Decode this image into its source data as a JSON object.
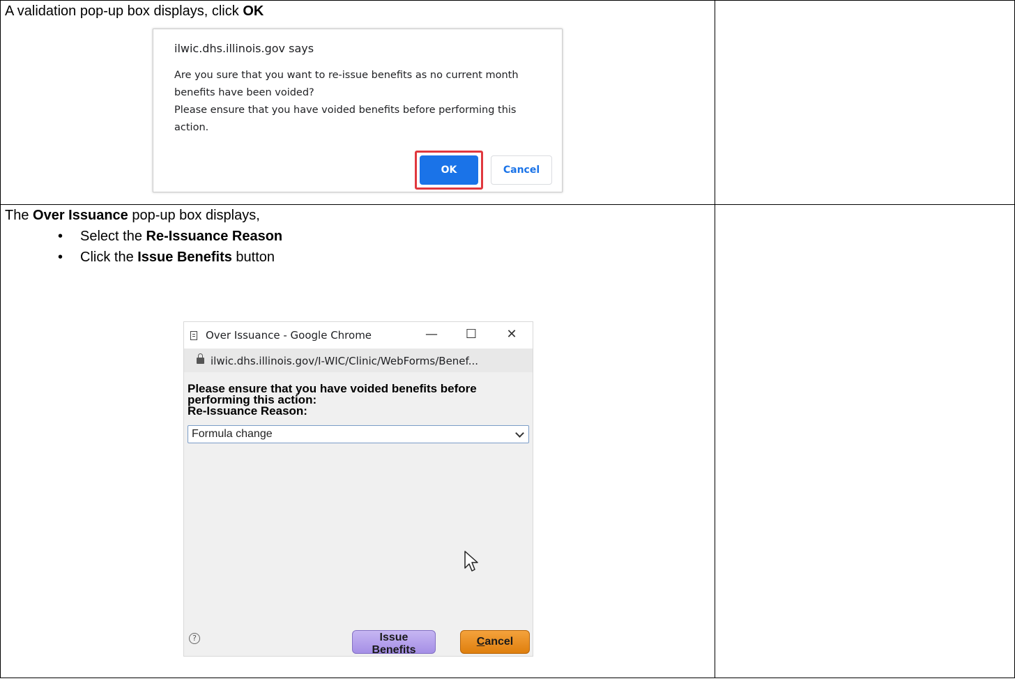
{
  "step1": {
    "text_before": "A validation pop-up box displays, click ",
    "text_bold": "OK"
  },
  "confirm_dialog": {
    "origin": "ilwic.dhs.illinois.gov says",
    "message_line1": "Are you sure that you want to re-issue benefits as no current month benefits have been voided?",
    "message_line2": "Please ensure that you have voided benefits before performing this action.",
    "ok_label": "OK",
    "cancel_label": "Cancel",
    "highlight_color": "#e0383e",
    "primary_color": "#1a73e8"
  },
  "step2": {
    "text_before": "The ",
    "text_bold": "Over Issuance",
    "text_after": " pop-up box displays,",
    "bullets": [
      {
        "before": "Select the ",
        "bold": "Re-Issuance Reason",
        "after": ""
      },
      {
        "before": "Click the ",
        "bold": "Issue Benefits",
        "after": " button"
      }
    ]
  },
  "popup_window": {
    "title": "Over Issuance - Google Chrome",
    "url": "ilwic.dhs.illinois.gov/I-WIC/Clinic/WebForms/Benef...",
    "heading_line1": "Please ensure that you have voided benefits before",
    "heading_line2": "performing this action:",
    "heading_line3": "Re-Issuance Reason:",
    "reason_selected": "Formula change",
    "help_glyph": "?",
    "issue_label": "Issue Benefits",
    "cancel_first_letter": "C",
    "cancel_rest": "ancel",
    "window_controls": {
      "minimize": "—",
      "maximize": "☐",
      "close": "✕"
    },
    "issue_color": "#a58fe6",
    "cancel_color": "#df7f0e"
  }
}
